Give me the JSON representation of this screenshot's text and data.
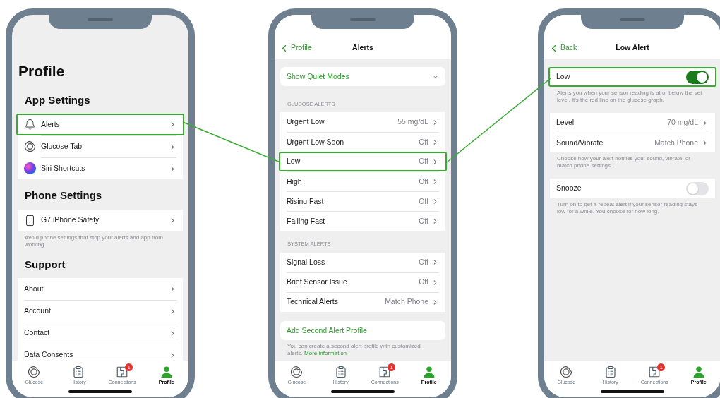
{
  "screens": [
    {
      "kind": "profile",
      "large_title": "Profile",
      "sections": [
        {
          "kind": "list",
          "heading": "App Settings",
          "rows": [
            {
              "kind": "link",
              "label": "Alerts",
              "highlighted": true
            },
            {
              "kind": "link",
              "label": "Glucose Tab",
              "highlighted": false
            },
            {
              "kind": "link",
              "label": "Siri Shortcuts",
              "highlighted": false
            }
          ]
        },
        {
          "kind": "list",
          "heading": "Phone Settings",
          "rows": [
            {
              "kind": "link",
              "label": "G7 iPhone Safety",
              "highlighted": false
            }
          ],
          "note": "Avoid phone settings that stop your alerts and app from working."
        },
        {
          "kind": "list",
          "heading": "Support",
          "rows": [
            {
              "kind": "link",
              "label": "About",
              "highlighted": false
            },
            {
              "kind": "link",
              "label": "Account",
              "highlighted": false
            },
            {
              "kind": "link",
              "label": "Contact",
              "highlighted": false
            },
            {
              "kind": "link",
              "label": "Data Consents",
              "highlighted": false
            }
          ]
        }
      ],
      "tab_bar": [
        {
          "label": "Glucose",
          "selected": false
        },
        {
          "label": "History",
          "selected": false
        },
        {
          "label": "Connections",
          "selected": false,
          "badge": "1"
        },
        {
          "label": "Profile",
          "selected": true
        }
      ]
    },
    {
      "kind": "detail",
      "nav": {
        "back": "Profile",
        "title": "Alerts"
      },
      "sections": [
        {
          "kind": "disclosure",
          "label": "Show Quiet Modes",
          "expanded": false
        },
        {
          "kind": "list",
          "heading": "GLUCOSE ALERTS",
          "rows": [
            {
              "kind": "link",
              "label": "Urgent Low",
              "value": "55 mg/dL",
              "highlighted": false
            },
            {
              "kind": "link",
              "label": "Urgent Low Soon",
              "value": "Off",
              "highlighted": false
            },
            {
              "kind": "link",
              "label": "Low",
              "value": "Off",
              "highlighted": true
            },
            {
              "kind": "link",
              "label": "High",
              "value": "Off",
              "highlighted": false
            },
            {
              "kind": "link",
              "label": "Rising Fast",
              "value": "Off",
              "highlighted": false
            },
            {
              "kind": "link",
              "label": "Falling Fast",
              "value": "Off",
              "highlighted": false
            }
          ]
        },
        {
          "kind": "list",
          "heading": "SYSTEM ALERTS",
          "rows": [
            {
              "kind": "link",
              "label": "Signal Loss",
              "value": "Off",
              "highlighted": false
            },
            {
              "kind": "link",
              "label": "Brief Sensor Issue",
              "value": "Off",
              "highlighted": false
            },
            {
              "kind": "link",
              "label": "Technical Alerts",
              "value": "Match Phone",
              "highlighted": false
            }
          ]
        },
        {
          "kind": "action",
          "label": "Add Second Alert Profile",
          "note": "You can create a second alert profile with customized alerts.",
          "note_link": "More information"
        }
      ],
      "tab_bar": [
        {
          "label": "Glucose",
          "selected": false
        },
        {
          "label": "History",
          "selected": false
        },
        {
          "label": "Connections",
          "selected": false,
          "badge": "1"
        },
        {
          "label": "Profile",
          "selected": true
        }
      ]
    },
    {
      "kind": "detail",
      "nav": {
        "back": "Back",
        "title": "Low Alert"
      },
      "sections": [
        {
          "kind": "list",
          "rows": [
            {
              "kind": "toggle",
              "label": "Low",
              "on": true,
              "highlighted": true
            }
          ],
          "note": "Alerts you when your sensor reading is at or below the set level. It's the red line on the glucose graph."
        },
        {
          "kind": "list",
          "rows": [
            {
              "kind": "link",
              "label": "Level",
              "value": "70 mg/dL",
              "highlighted": false
            },
            {
              "kind": "link",
              "label": "Sound/Vibrate",
              "value": "Match Phone",
              "highlighted": false
            }
          ],
          "note": "Choose how your alert notifies you: sound, vibrate, or match phone settings."
        },
        {
          "kind": "list",
          "rows": [
            {
              "kind": "toggle",
              "label": "Snooze",
              "on": false,
              "highlighted": false
            }
          ],
          "note": "Turn on to get a repeat alert if your sensor reading stays low for a while. You choose for how long."
        }
      ],
      "tab_bar": [
        {
          "label": "Glucose",
          "selected": false
        },
        {
          "label": "History",
          "selected": false
        },
        {
          "label": "Connections",
          "selected": false,
          "badge": "1"
        },
        {
          "label": "Profile",
          "selected": true
        }
      ]
    }
  ]
}
